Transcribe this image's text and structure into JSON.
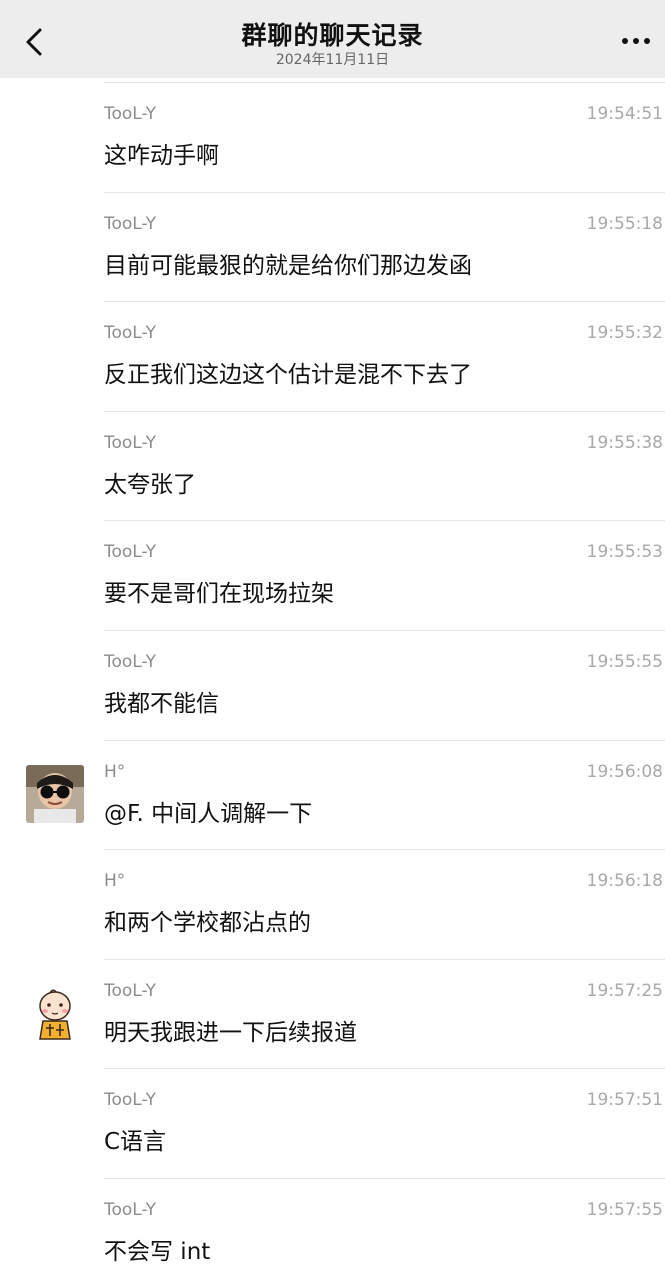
{
  "header": {
    "title": "群聊的聊天记录",
    "date": "2024年11月11日"
  },
  "messages": [
    {
      "sender": "TooL-Y",
      "time": "19:54:51",
      "text": "这咋动手啊",
      "avatar": null
    },
    {
      "sender": "TooL-Y",
      "time": "19:55:18",
      "text": "目前可能最狠的就是给你们那边发函",
      "avatar": null
    },
    {
      "sender": "TooL-Y",
      "time": "19:55:32",
      "text": "反正我们这边这个估计是混不下去了",
      "avatar": null
    },
    {
      "sender": "TooL-Y",
      "time": "19:55:38",
      "text": "太夸张了",
      "avatar": null
    },
    {
      "sender": "TooL-Y",
      "time": "19:55:53",
      "text": "要不是哥们在现场拉架",
      "avatar": null
    },
    {
      "sender": "TooL-Y",
      "time": "19:55:55",
      "text": "我都不能信",
      "avatar": null
    },
    {
      "sender": "H°",
      "time": "19:56:08",
      "text": "@F. 中间人调解一下",
      "avatar": "photo-avatar-sunglasses-kid"
    },
    {
      "sender": "H°",
      "time": "19:56:18",
      "text": "和两个学校都沾点的",
      "avatar": null
    },
    {
      "sender": "TooL-Y",
      "time": "19:57:25",
      "text": "明天我跟进一下后续报道",
      "avatar": "cartoon-avatar-baby"
    },
    {
      "sender": "TooL-Y",
      "time": "19:57:51",
      "text": "C语言",
      "avatar": null
    },
    {
      "sender": "TooL-Y",
      "time": "19:57:55",
      "text": "不会写 int",
      "avatar": null
    }
  ],
  "icons": {
    "back": "chevron-left-icon",
    "more": "more-dots-icon"
  },
  "colors": {
    "header_bg": "#ededed",
    "sender": "#8c8c8c",
    "time": "#a8a8a8",
    "divider": "#e5e5e5"
  }
}
